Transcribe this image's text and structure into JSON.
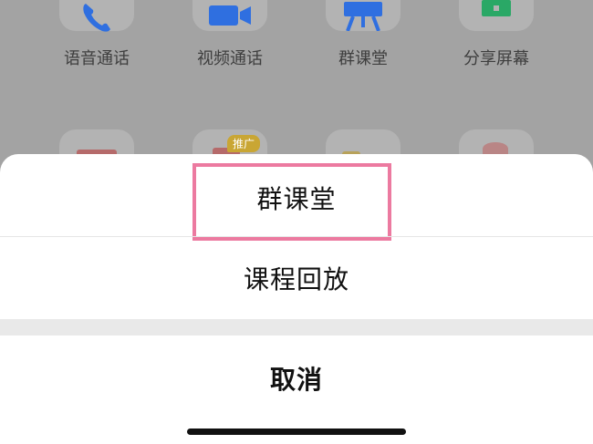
{
  "background_grid": {
    "row1": [
      {
        "label": "语音通话",
        "icon": "phone-icon",
        "color": "#2f6fe0"
      },
      {
        "label": "视频通话",
        "icon": "video-camera-icon",
        "color": "#2f6fe0"
      },
      {
        "label": "群课堂",
        "icon": "easel-icon",
        "color": "#2f6fe0"
      },
      {
        "label": "分享屏幕",
        "icon": "share-screen-icon",
        "color": "#2aa866"
      }
    ],
    "row2_badge": "推广"
  },
  "action_sheet": {
    "options": [
      {
        "label": "群课堂",
        "highlighted": true
      },
      {
        "label": "课程回放",
        "highlighted": false
      }
    ],
    "cancel_label": "取消",
    "highlight_color": "#ec7aa0"
  }
}
